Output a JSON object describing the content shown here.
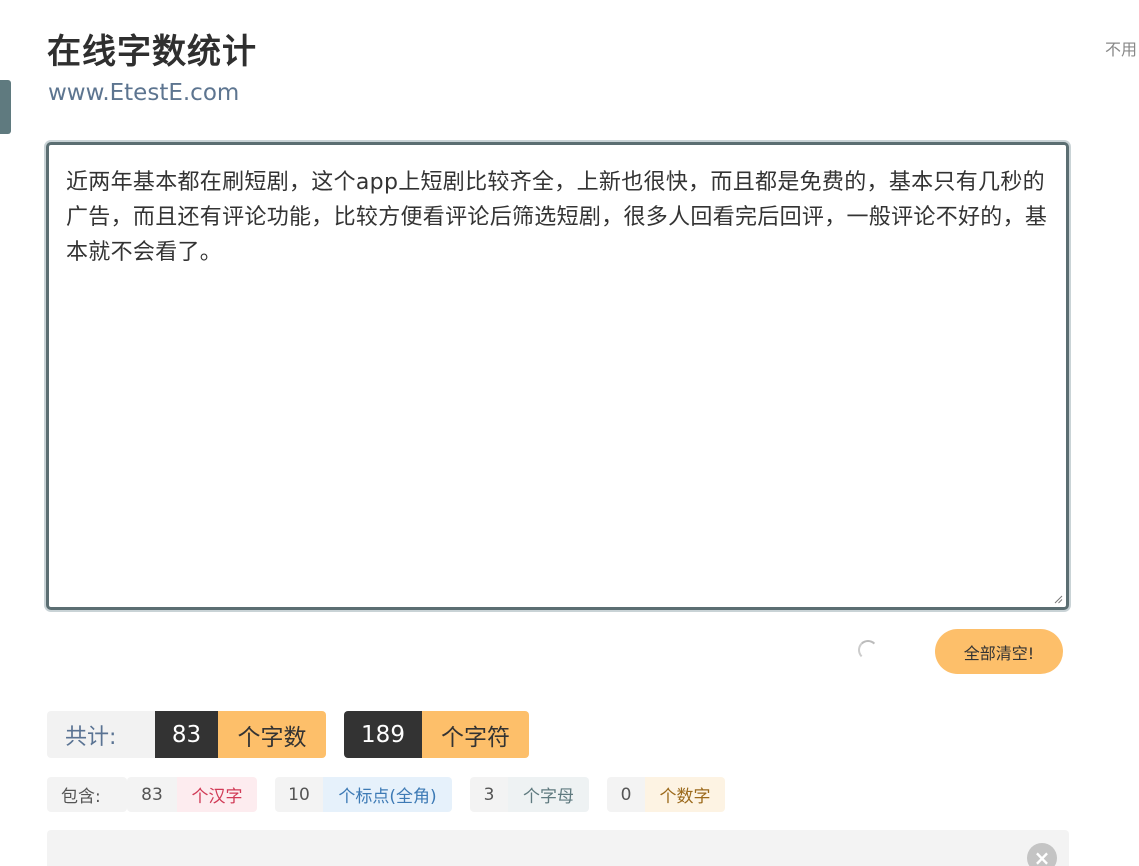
{
  "header": {
    "title": "在线字数统计",
    "subtitle": "www.EtestE.com",
    "corner_note": "不用"
  },
  "editor": {
    "text": "近两年基本都在刷短剧，这个app上短剧比较齐全，上新也很快，而且都是免费的，基本只有几秒的广告，而且还有评论功能，比较方便看评论后筛选短剧，很多人回看完后回评，一般评论不好的，基本就不会看了。"
  },
  "actions": {
    "clear_label": "全部清空!"
  },
  "totals": {
    "label": "共计:",
    "words_count": "83",
    "words_unit": "个字数",
    "chars_count": "189",
    "chars_unit": "个字符"
  },
  "details": {
    "label": "包含:",
    "hanzi_count": "83",
    "hanzi_unit": "个汉字",
    "punct_count": "10",
    "punct_unit": "个标点(全角)",
    "letters_count": "3",
    "letters_unit": "个字母",
    "digits_count": "0",
    "digits_unit": "个数字"
  },
  "colors": {
    "accent": "#fdbf6a",
    "dark_pill": "#333333",
    "editor_border": "#5b6e72",
    "hanzi_tag_bg": "#fdecef",
    "hanzi_tag_fg": "#d13a56",
    "punct_tag_bg": "#e6f1fb",
    "punct_tag_fg": "#3d7ab5",
    "letters_tag_bg": "#eef2f3",
    "letters_tag_fg": "#5f7a7f",
    "digits_tag_bg": "#fdf3e3",
    "digits_tag_fg": "#9c6a1c"
  },
  "icons": {
    "spinner": "loading-spinner-icon",
    "close": "close-circle-icon",
    "resize": "resize-grip-icon"
  }
}
